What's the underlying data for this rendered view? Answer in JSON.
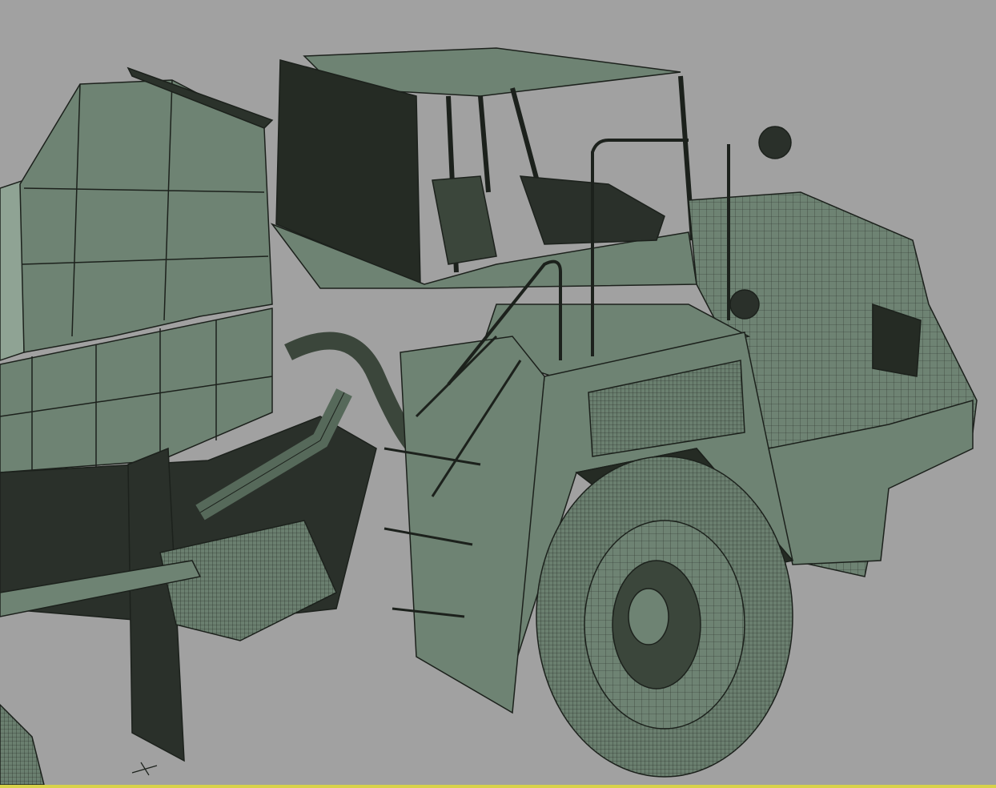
{
  "viewport": {
    "background_color": "#a1a1a1",
    "model_fill": "#6e8373",
    "model_light": "#8fa394",
    "model_dark": "#252b24",
    "wire_color": "#1c211c",
    "cursor_icon": "crosshair-icon"
  }
}
